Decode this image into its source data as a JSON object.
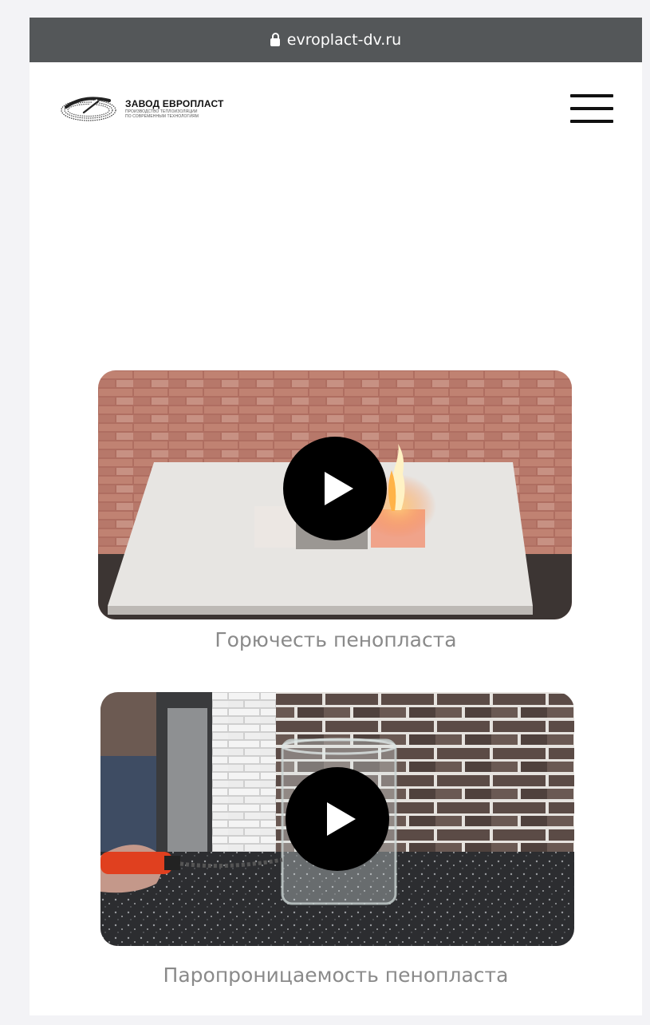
{
  "browser": {
    "url": "evroplact-dv.ru"
  },
  "header": {
    "logo_title": "ЗАВОД ЕВРОПЛАСТ",
    "logo_sub_1": "ПРОИЗВОДСТВО ТЕПЛОИЗОЛЯЦИИ",
    "logo_sub_2": "ПО СОВРЕМЕННЫМ ТЕХНОЛОГИЯМ"
  },
  "videos": [
    {
      "caption": "Горючесть пенопласта",
      "icon": "play-icon"
    },
    {
      "caption": "Паропроницаемость пенопласта",
      "icon": "play-icon"
    }
  ],
  "colors": {
    "url_bar": "#545759",
    "play_button": "#000000",
    "caption": "#8a8a8a"
  }
}
